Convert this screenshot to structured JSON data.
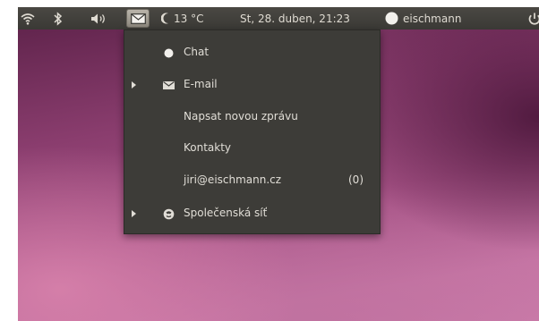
{
  "panel": {
    "temperature": "13 °C",
    "datetime": "St, 28. duben, 21:23",
    "username": "eischmann"
  },
  "menu": {
    "chat": "Chat",
    "email": "E-mail",
    "compose": "Napsat novou zprávu",
    "contacts": "Kontakty",
    "account": "jiri@eischmann.cz",
    "account_count": "(0)",
    "social": "Společenská síť"
  },
  "colors": {
    "panel_bg": "#3c3b37",
    "menu_bg": "#3d3c38",
    "text": "#e0ddd6"
  }
}
